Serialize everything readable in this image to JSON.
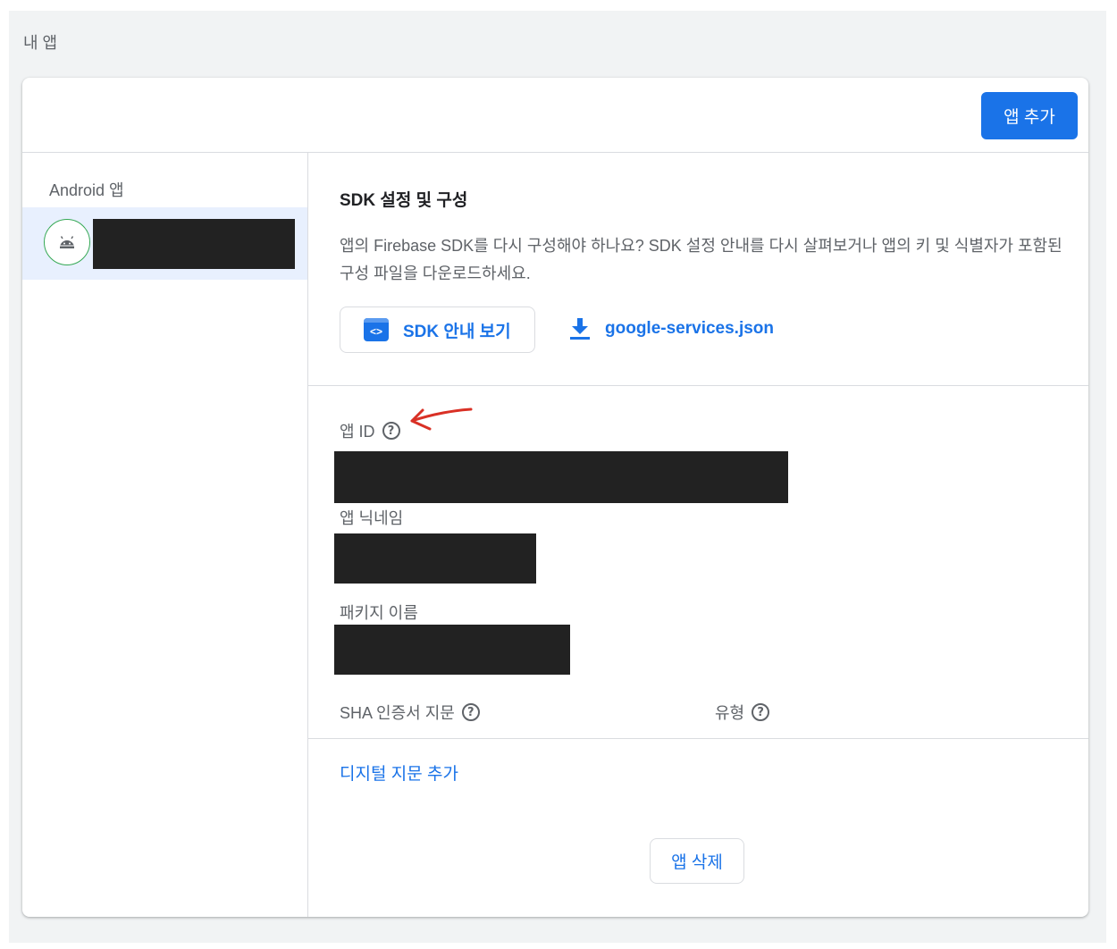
{
  "page": {
    "section_title": "내 앱"
  },
  "header": {
    "add_app_label": "앱 추가"
  },
  "sidebar": {
    "heading": "Android 앱",
    "apps": [
      {
        "icon": "android-icon",
        "name_redacted": true
      }
    ]
  },
  "sdk": {
    "title": "SDK 설정 및 구성",
    "description": "앱의 Firebase SDK를 다시 구성해야 하나요? SDK 설정 안내를 다시 살펴보거나 앱의 키 및 식별자가 포함된 구성 파일을 다운로드하세요.",
    "instructions_label": "SDK 안내 보기",
    "download_label": "google-services.json"
  },
  "fields": {
    "app_id_label": "앱 ID",
    "nickname_label": "앱 닉네임",
    "package_label": "패키지 이름",
    "sha_label": "SHA 인증서 지문",
    "type_label": "유형"
  },
  "actions": {
    "add_fingerprint": "디지털 지문 추가",
    "delete_app": "앱 삭제"
  },
  "colors": {
    "accent": "#1a73e8",
    "annotation": "#d93025",
    "android_ring": "#34a853"
  }
}
